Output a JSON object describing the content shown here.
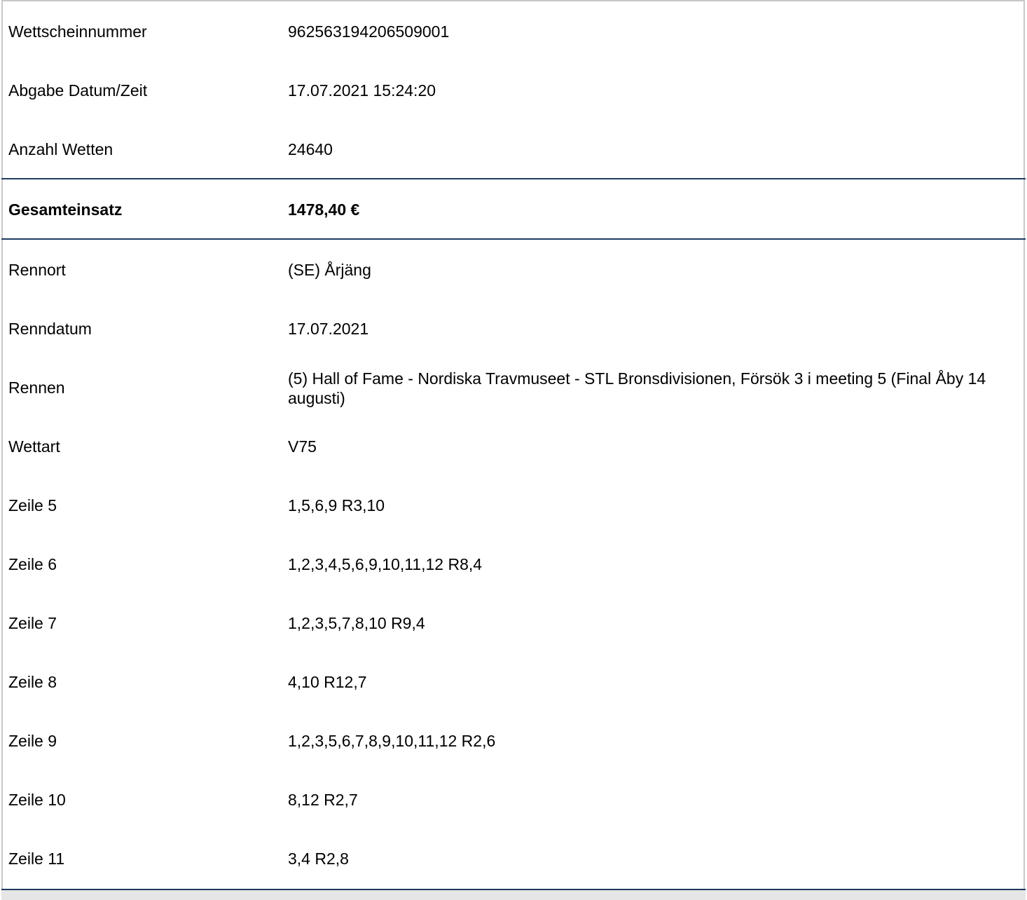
{
  "ticket": {
    "rows": [
      {
        "label": "Wettscheinnummer",
        "value": "962563194206509001"
      },
      {
        "label": "Abgabe Datum/Zeit",
        "value": "17.07.2021 15:24:20"
      },
      {
        "label": "Anzahl Wetten",
        "value": "24640"
      }
    ],
    "total": {
      "label": "Gesamteinsatz",
      "value": "1478,40 €"
    },
    "race_rows": [
      {
        "label": "Rennort",
        "value": "(SE) Årjäng"
      },
      {
        "label": "Renndatum",
        "value": "17.07.2021"
      },
      {
        "label": "Rennen",
        "value": "(5) Hall of Fame - Nordiska Travmuseet - STL Bronsdivisionen, Försök 3 i meeting 5 (Final Åby 14 augusti)"
      },
      {
        "label": "Wettart",
        "value": "V75"
      },
      {
        "label": "Zeile 5",
        "value": "1,5,6,9 R3,10"
      },
      {
        "label": "Zeile 6",
        "value": "1,2,3,4,5,6,9,10,11,12 R8,4"
      },
      {
        "label": "Zeile 7",
        "value": "1,2,3,5,7,8,10 R9,4"
      },
      {
        "label": "Zeile 8",
        "value": "4,10 R12,7"
      },
      {
        "label": "Zeile 9",
        "value": "1,2,3,5,6,7,8,9,10,11,12 R2,6"
      },
      {
        "label": "Zeile 10",
        "value": "8,12 R2,7"
      },
      {
        "label": "Zeile 11",
        "value": "3,4 R2,8"
      }
    ]
  }
}
